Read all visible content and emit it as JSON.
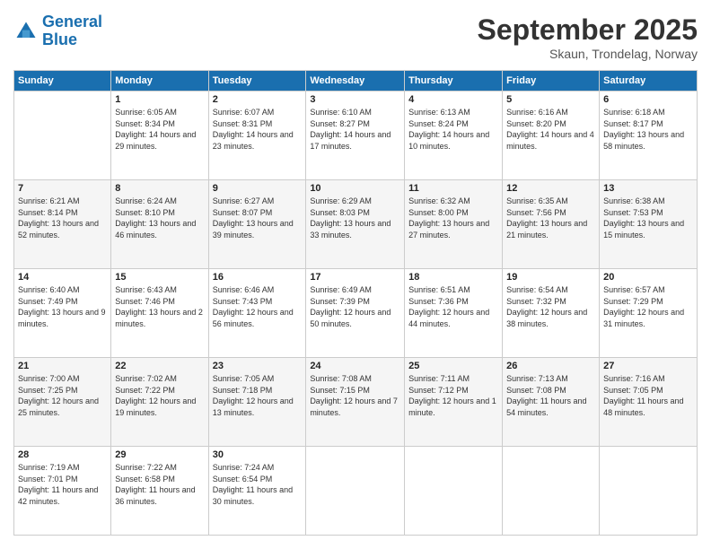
{
  "logo": {
    "line1": "General",
    "line2": "Blue"
  },
  "title": "September 2025",
  "location": "Skaun, Trondelag, Norway",
  "days_header": [
    "Sunday",
    "Monday",
    "Tuesday",
    "Wednesday",
    "Thursday",
    "Friday",
    "Saturday"
  ],
  "weeks": [
    [
      {
        "num": "",
        "sunrise": "",
        "sunset": "",
        "daylight": ""
      },
      {
        "num": "1",
        "sunrise": "Sunrise: 6:05 AM",
        "sunset": "Sunset: 8:34 PM",
        "daylight": "Daylight: 14 hours and 29 minutes."
      },
      {
        "num": "2",
        "sunrise": "Sunrise: 6:07 AM",
        "sunset": "Sunset: 8:31 PM",
        "daylight": "Daylight: 14 hours and 23 minutes."
      },
      {
        "num": "3",
        "sunrise": "Sunrise: 6:10 AM",
        "sunset": "Sunset: 8:27 PM",
        "daylight": "Daylight: 14 hours and 17 minutes."
      },
      {
        "num": "4",
        "sunrise": "Sunrise: 6:13 AM",
        "sunset": "Sunset: 8:24 PM",
        "daylight": "Daylight: 14 hours and 10 minutes."
      },
      {
        "num": "5",
        "sunrise": "Sunrise: 6:16 AM",
        "sunset": "Sunset: 8:20 PM",
        "daylight": "Daylight: 14 hours and 4 minutes."
      },
      {
        "num": "6",
        "sunrise": "Sunrise: 6:18 AM",
        "sunset": "Sunset: 8:17 PM",
        "daylight": "Daylight: 13 hours and 58 minutes."
      }
    ],
    [
      {
        "num": "7",
        "sunrise": "Sunrise: 6:21 AM",
        "sunset": "Sunset: 8:14 PM",
        "daylight": "Daylight: 13 hours and 52 minutes."
      },
      {
        "num": "8",
        "sunrise": "Sunrise: 6:24 AM",
        "sunset": "Sunset: 8:10 PM",
        "daylight": "Daylight: 13 hours and 46 minutes."
      },
      {
        "num": "9",
        "sunrise": "Sunrise: 6:27 AM",
        "sunset": "Sunset: 8:07 PM",
        "daylight": "Daylight: 13 hours and 39 minutes."
      },
      {
        "num": "10",
        "sunrise": "Sunrise: 6:29 AM",
        "sunset": "Sunset: 8:03 PM",
        "daylight": "Daylight: 13 hours and 33 minutes."
      },
      {
        "num": "11",
        "sunrise": "Sunrise: 6:32 AM",
        "sunset": "Sunset: 8:00 PM",
        "daylight": "Daylight: 13 hours and 27 minutes."
      },
      {
        "num": "12",
        "sunrise": "Sunrise: 6:35 AM",
        "sunset": "Sunset: 7:56 PM",
        "daylight": "Daylight: 13 hours and 21 minutes."
      },
      {
        "num": "13",
        "sunrise": "Sunrise: 6:38 AM",
        "sunset": "Sunset: 7:53 PM",
        "daylight": "Daylight: 13 hours and 15 minutes."
      }
    ],
    [
      {
        "num": "14",
        "sunrise": "Sunrise: 6:40 AM",
        "sunset": "Sunset: 7:49 PM",
        "daylight": "Daylight: 13 hours and 9 minutes."
      },
      {
        "num": "15",
        "sunrise": "Sunrise: 6:43 AM",
        "sunset": "Sunset: 7:46 PM",
        "daylight": "Daylight: 13 hours and 2 minutes."
      },
      {
        "num": "16",
        "sunrise": "Sunrise: 6:46 AM",
        "sunset": "Sunset: 7:43 PM",
        "daylight": "Daylight: 12 hours and 56 minutes."
      },
      {
        "num": "17",
        "sunrise": "Sunrise: 6:49 AM",
        "sunset": "Sunset: 7:39 PM",
        "daylight": "Daylight: 12 hours and 50 minutes."
      },
      {
        "num": "18",
        "sunrise": "Sunrise: 6:51 AM",
        "sunset": "Sunset: 7:36 PM",
        "daylight": "Daylight: 12 hours and 44 minutes."
      },
      {
        "num": "19",
        "sunrise": "Sunrise: 6:54 AM",
        "sunset": "Sunset: 7:32 PM",
        "daylight": "Daylight: 12 hours and 38 minutes."
      },
      {
        "num": "20",
        "sunrise": "Sunrise: 6:57 AM",
        "sunset": "Sunset: 7:29 PM",
        "daylight": "Daylight: 12 hours and 31 minutes."
      }
    ],
    [
      {
        "num": "21",
        "sunrise": "Sunrise: 7:00 AM",
        "sunset": "Sunset: 7:25 PM",
        "daylight": "Daylight: 12 hours and 25 minutes."
      },
      {
        "num": "22",
        "sunrise": "Sunrise: 7:02 AM",
        "sunset": "Sunset: 7:22 PM",
        "daylight": "Daylight: 12 hours and 19 minutes."
      },
      {
        "num": "23",
        "sunrise": "Sunrise: 7:05 AM",
        "sunset": "Sunset: 7:18 PM",
        "daylight": "Daylight: 12 hours and 13 minutes."
      },
      {
        "num": "24",
        "sunrise": "Sunrise: 7:08 AM",
        "sunset": "Sunset: 7:15 PM",
        "daylight": "Daylight: 12 hours and 7 minutes."
      },
      {
        "num": "25",
        "sunrise": "Sunrise: 7:11 AM",
        "sunset": "Sunset: 7:12 PM",
        "daylight": "Daylight: 12 hours and 1 minute."
      },
      {
        "num": "26",
        "sunrise": "Sunrise: 7:13 AM",
        "sunset": "Sunset: 7:08 PM",
        "daylight": "Daylight: 11 hours and 54 minutes."
      },
      {
        "num": "27",
        "sunrise": "Sunrise: 7:16 AM",
        "sunset": "Sunset: 7:05 PM",
        "daylight": "Daylight: 11 hours and 48 minutes."
      }
    ],
    [
      {
        "num": "28",
        "sunrise": "Sunrise: 7:19 AM",
        "sunset": "Sunset: 7:01 PM",
        "daylight": "Daylight: 11 hours and 42 minutes."
      },
      {
        "num": "29",
        "sunrise": "Sunrise: 7:22 AM",
        "sunset": "Sunset: 6:58 PM",
        "daylight": "Daylight: 11 hours and 36 minutes."
      },
      {
        "num": "30",
        "sunrise": "Sunrise: 7:24 AM",
        "sunset": "Sunset: 6:54 PM",
        "daylight": "Daylight: 11 hours and 30 minutes."
      },
      {
        "num": "",
        "sunrise": "",
        "sunset": "",
        "daylight": ""
      },
      {
        "num": "",
        "sunrise": "",
        "sunset": "",
        "daylight": ""
      },
      {
        "num": "",
        "sunrise": "",
        "sunset": "",
        "daylight": ""
      },
      {
        "num": "",
        "sunrise": "",
        "sunset": "",
        "daylight": ""
      }
    ]
  ]
}
